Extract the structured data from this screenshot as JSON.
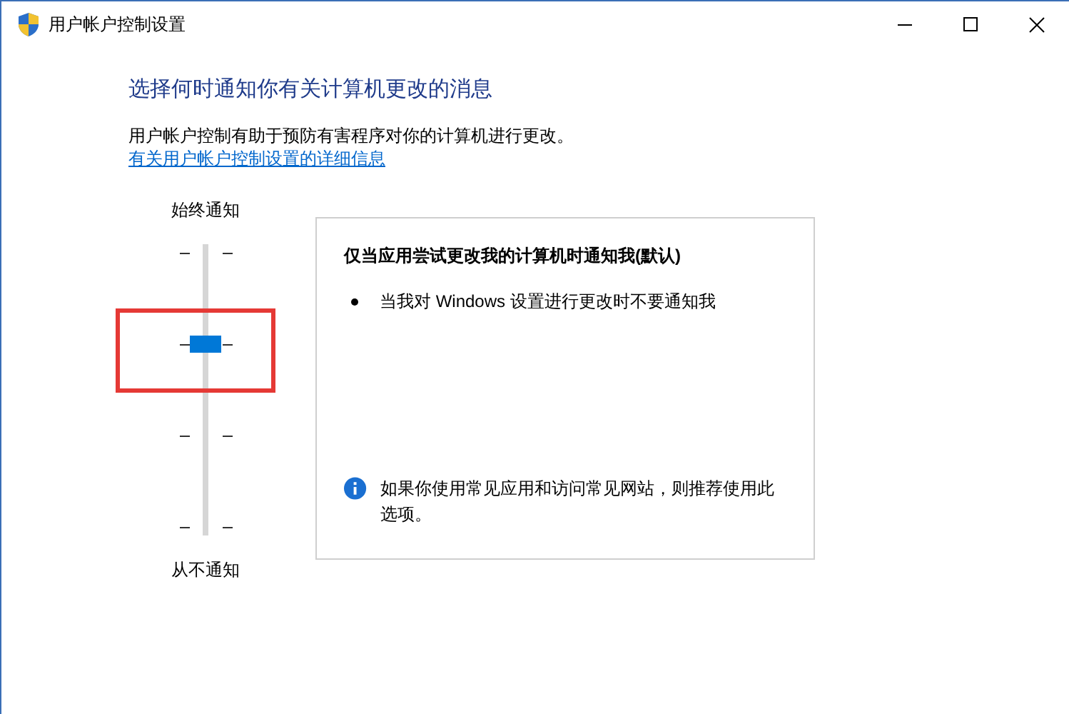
{
  "window": {
    "title": "用户帐户控制设置"
  },
  "heading": "选择何时通知你有关计算机更改的消息",
  "description": "用户帐户控制有助于预防有害程序对你的计算机进行更改。",
  "link": "有关用户帐户控制设置的详细信息",
  "slider": {
    "top_label": "始终通知",
    "bottom_label": "从不通知",
    "level": 0.667
  },
  "detail": {
    "title": "仅当应用尝试更改我的计算机时通知我(默认)",
    "bullets": [
      "当我对 Windows 设置进行更改时不要通知我"
    ],
    "info": "如果你使用常见应用和访问常见网站，则推荐使用此选项。"
  }
}
